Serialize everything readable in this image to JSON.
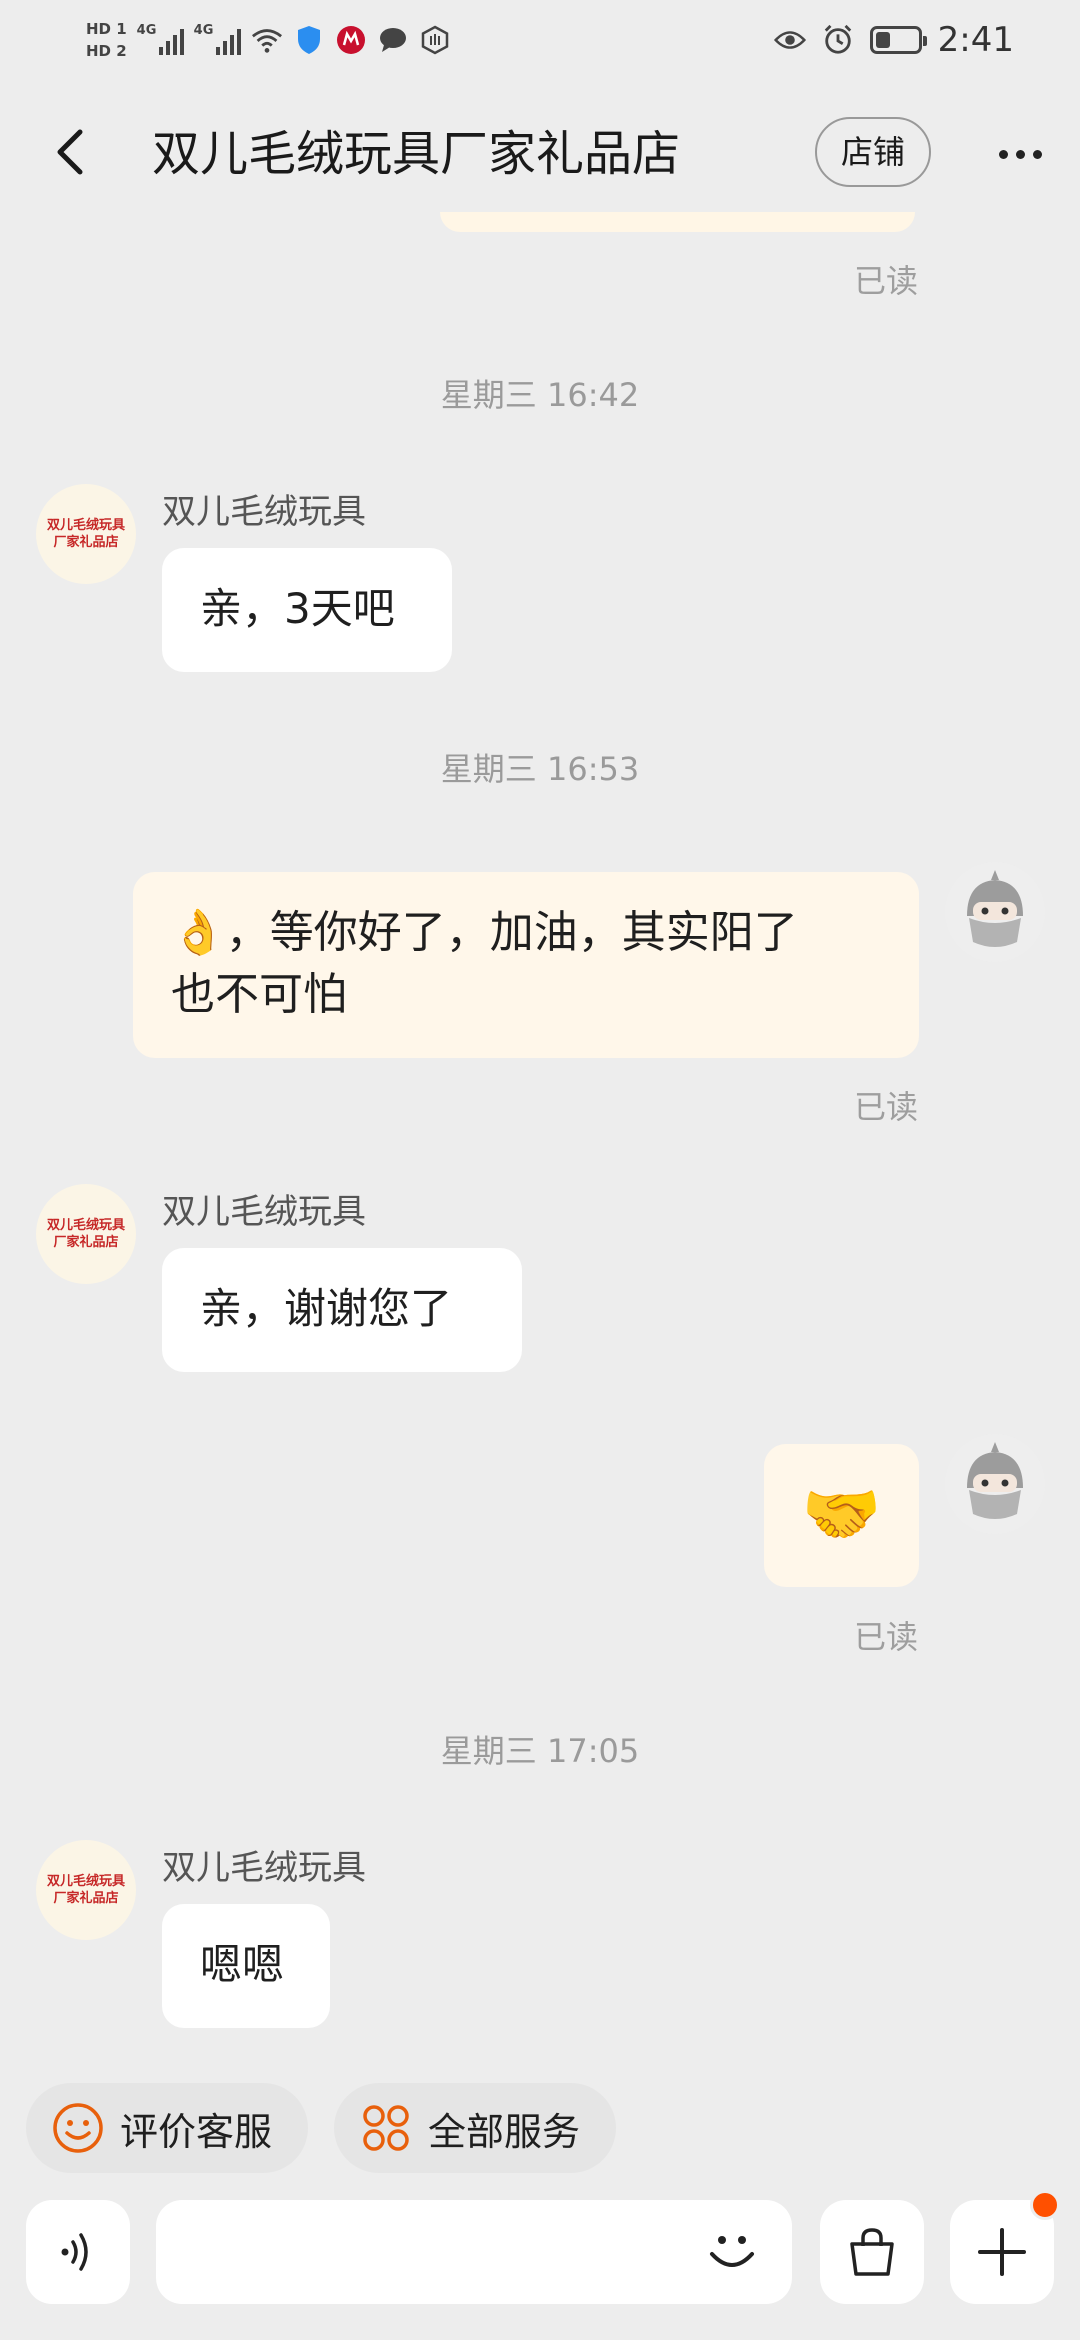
{
  "status_bar": {
    "sim1": "HD 1",
    "sim2": "HD 2",
    "net1": "4G",
    "net2": "4G",
    "time": "2:41",
    "battery_level": 0.35
  },
  "header": {
    "title": "双儿毛绒玩具厂家礼品店",
    "shop_button": "店铺"
  },
  "messages": {
    "read_status": "已读",
    "timestamps": [
      "星期三 16:42",
      "星期三 16:53",
      "星期三 17:05"
    ],
    "shop_name": "双儿毛绒玩具",
    "shop_avatar_text": "双儿毛绒玩具厂家礼品店",
    "msg1": "亲，3天吧",
    "msg2_line1": "👌，等你好了，加油，其实阳了",
    "msg2_line2": "也不可怕",
    "msg3": "亲，谢谢您了",
    "msg4_emoji": "🤝",
    "msg5": "嗯嗯"
  },
  "quick_actions": {
    "rate": "评价客服",
    "services": "全部服务"
  },
  "input_bar": {
    "placeholder": ""
  },
  "colors": {
    "accent": "#ff5000",
    "bubble_mine": "#fff7ea",
    "bubble_theirs": "#ffffff",
    "background": "#ededed"
  }
}
